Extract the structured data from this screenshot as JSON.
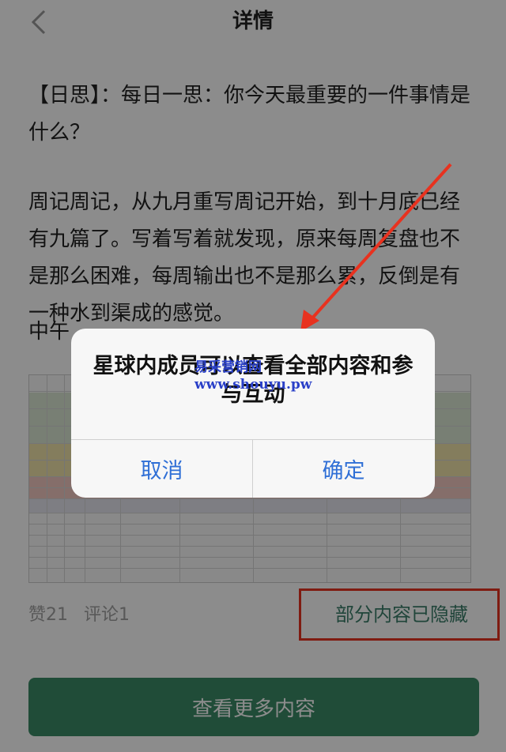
{
  "header": {
    "title": "详情"
  },
  "article": {
    "para1": "【日思】：每日一思：你今天最重要的一件事情是什么？",
    "para2": "周记周记，从九月重写周记开始，到十月底已经有九篇了。写着写着就发现，原来每周复盘也不是那么困难，每周输出也不是那么累，反倒是有一种水到渠成的感觉。",
    "para3": "中午"
  },
  "meta": {
    "likes": "赞21",
    "comments": "评论1",
    "hidden_note": "部分内容已隐藏"
  },
  "more_button": {
    "label": "查看更多内容"
  },
  "dialog": {
    "message": "星球内成员可以查看全部内容和参与互动",
    "cancel_label": "取消",
    "ok_label": "确定"
  },
  "watermark": {
    "line1": "易采营销网",
    "line2": "www.shouyu.pw"
  },
  "colors": {
    "accent_green": "#3b8a66",
    "dialog_button_blue": "#2f6fd6",
    "annotation_red": "#e8321f"
  }
}
